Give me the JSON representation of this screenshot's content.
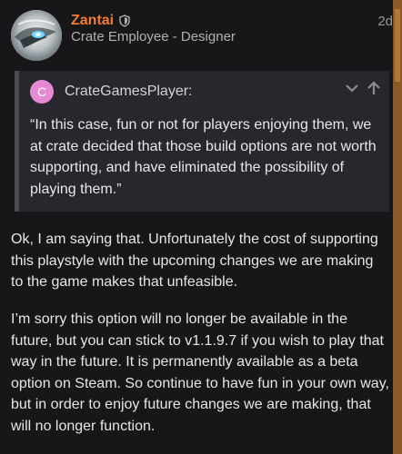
{
  "post": {
    "username": "Zantai",
    "user_title": "Crate Employee - Designer",
    "date": "2d",
    "badge_icon": "shield-icon"
  },
  "quote": {
    "avatar_letter": "C",
    "username": "CrateGamesPlayer:",
    "text": "“In this case, fun or not for players enjoying them, we at crate decided that those build options are not worth supporting, and have eliminated the possibility of playing them.”",
    "avatar_color": "#e58ad2"
  },
  "paragraphs": [
    "Ok, I am saying that. Unfortunately the cost of supporting this playstyle with the upcoming changes we are making to the game makes that unfeasible.",
    "I’m sorry this option will no longer be available in the future, but you can stick to v1.1.9.7 if you wish to play that way in the future. It is permanently available as a beta option on Steam. So continue to have fun in your own way, but in order to enjoy future changes we are making, that will no longer function."
  ],
  "colors": {
    "background": "#17171a",
    "username": "#f47b32",
    "quote_background": "#27272d"
  }
}
